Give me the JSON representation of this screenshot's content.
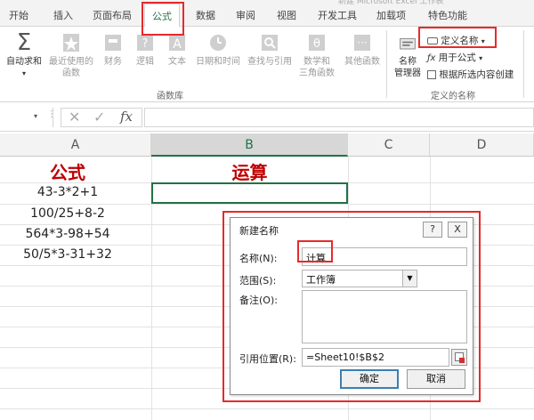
{
  "tabs": [
    "开始",
    "插入",
    "页面布局",
    "公式",
    "数据",
    "审阅",
    "视图",
    "开发工具",
    "加载项",
    "特色功能"
  ],
  "active_tab": "公式",
  "top_strip_text": "新建 Microsoft Excel 工作表",
  "ribbon": {
    "autosum": "自动求和",
    "recent_line1": "最近使用的",
    "recent_line2": "函数",
    "finance": "财务",
    "logic": "逻辑",
    "text": "文本",
    "datetime": "日期和时间",
    "lookup": "查找与引用",
    "math_line1": "数学和",
    "math_line2": "三角函数",
    "other": "其他函数",
    "function_library": "函数库",
    "name_manager_line1": "名称",
    "name_manager_line2": "管理器",
    "define_name": "定义名称",
    "use_in_formula": "用于公式",
    "create_from_selection": "根据所选内容创建",
    "defined_names": "定义的名称"
  },
  "formula_bar": {
    "fx": "fx"
  },
  "grid": {
    "col_headers": [
      "A",
      "B",
      "C",
      "D"
    ],
    "header_a": "公式",
    "header_b": "运算",
    "formulas": [
      "43-3*2+1",
      "100/25+8-2",
      "564*3-98+54",
      "50/5*3-31+32"
    ]
  },
  "dialog": {
    "title": "新建名称",
    "help": "?",
    "close": "X",
    "name_label": "名称(N):",
    "name_value": "计算",
    "scope_label": "范围(S):",
    "scope_value": "工作簿",
    "comment_label": "备注(O):",
    "ref_label": "引用位置(R):",
    "ref_value": "=Sheet10!$B$2",
    "ok": "确定",
    "cancel": "取消"
  },
  "colors": {
    "accent": "#217346",
    "highlight": "#e52b2b",
    "header_red": "#c00000"
  }
}
